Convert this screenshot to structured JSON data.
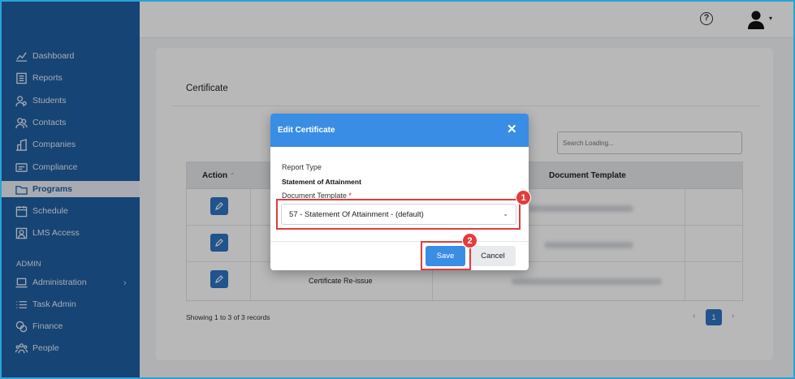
{
  "sidebar": {
    "items": [
      {
        "label": "Dashboard",
        "icon": "chart-line-icon"
      },
      {
        "label": "Reports",
        "icon": "report-icon"
      },
      {
        "label": "Students",
        "icon": "students-icon"
      },
      {
        "label": "Contacts",
        "icon": "contacts-icon"
      },
      {
        "label": "Companies",
        "icon": "building-icon"
      },
      {
        "label": "Compliance",
        "icon": "id-card-icon"
      },
      {
        "label": "Programs",
        "icon": "programs-icon"
      },
      {
        "label": "Schedule",
        "icon": "calendar-icon"
      },
      {
        "label": "LMS Access",
        "icon": "lms-icon"
      }
    ],
    "section_label": "ADMIN",
    "admin_items": [
      {
        "label": "Administration",
        "icon": "laptop-icon"
      },
      {
        "label": "Task Admin",
        "icon": "list-icon"
      },
      {
        "label": "Finance",
        "icon": "finance-icon"
      },
      {
        "label": "People",
        "icon": "people-icon"
      }
    ],
    "active": "Programs",
    "bg_color": "#1f5fa3"
  },
  "topbar": {
    "help_glyph": "?",
    "user_caret": "▾"
  },
  "page": {
    "title": "Certificate",
    "search_placeholder": "Search Loading...",
    "columns": {
      "action": "Action",
      "sort_glyph": "⌃",
      "template": "Document Template"
    },
    "row3_name": "Certificate Re-issue",
    "records": "Showing 1 to 3 of 3 records",
    "pager": {
      "prev": "‹",
      "current": "1",
      "next": "›"
    }
  },
  "modal": {
    "title": "Edit Certificate",
    "close": "✕",
    "report_type_label": "Report Type",
    "report_type_value": "Statement of Attainment",
    "template_label": "Document Template",
    "required_mark": "*",
    "template_value": "57 - Statement Of Attainment - (default)",
    "select_chevron": "⌄",
    "save": "Save",
    "cancel": "Cancel",
    "accent": "#3a8de4"
  },
  "annotations": {
    "badge1": "1",
    "badge2": "2",
    "color": "#e23c3c"
  }
}
